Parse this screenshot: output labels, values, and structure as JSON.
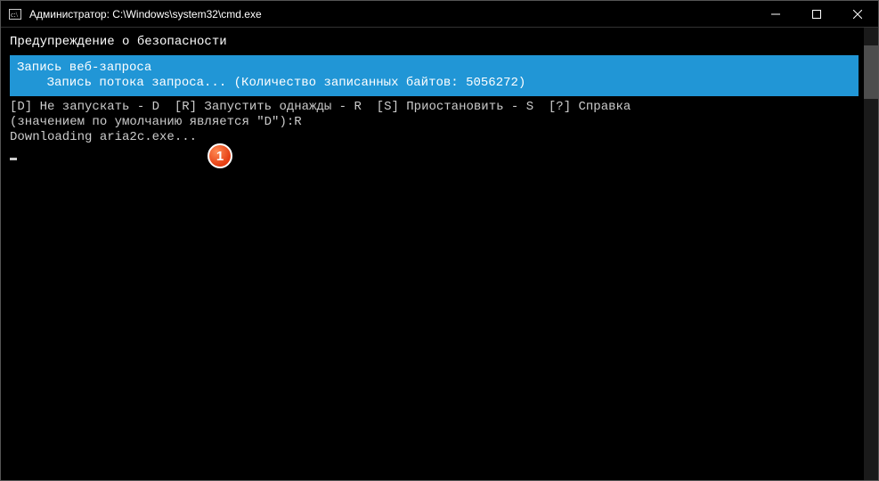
{
  "titlebar": {
    "title": "Администратор: C:\\Windows\\system32\\cmd.exe"
  },
  "content": {
    "warning": "Предупреждение о безопасности",
    "progress_line1": "Запись веб-запроса",
    "progress_line2": "    Запись потока запроса... (Количество записанных байтов: 5056272)",
    "options_line": "[D] Не запускать - D  [R] Запустить однажды - R  [S] Приостановить - S  [?] Справка",
    "default_line": "(значением по умолчанию является \"D\"):R",
    "downloading": "Downloading aria2c.exe..."
  },
  "callout": {
    "number": "1"
  }
}
